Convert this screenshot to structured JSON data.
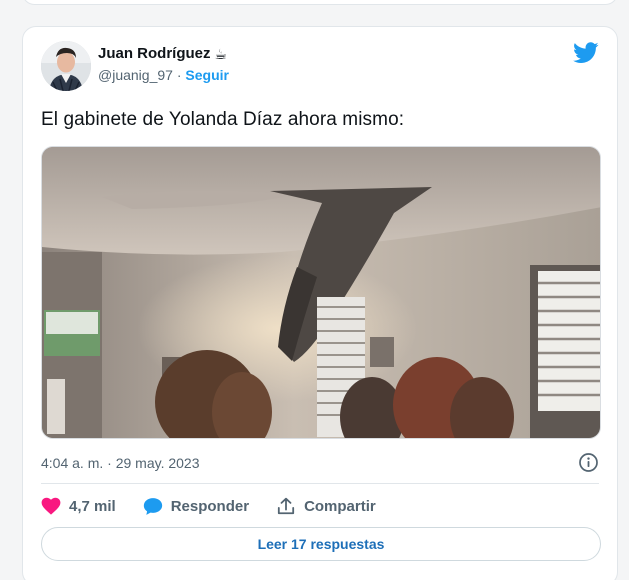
{
  "tweet": {
    "author_name": "Juan Rodríguez",
    "author_emoji": "☕",
    "handle": "@juanig_97",
    "separator": " · ",
    "follow_label": "Seguir",
    "text": "El gabinete de Yolanda Díaz ahora mismo:",
    "media_icon": "embedded-video-still",
    "timestamp": "4:04 a. m. · 29 may. 2023",
    "likes": "4,7 mil",
    "reply_label": "Responder",
    "share_label": "Compartir",
    "read_replies_label": "Leer 17 respuestas"
  },
  "icons": {
    "brand": "twitter-bird-icon",
    "info": "info-icon",
    "like": "heart-icon",
    "reply": "speech-bubble-icon",
    "share": "share-upload-icon"
  },
  "colors": {
    "brand_blue": "#1d9bf0",
    "heart": "#f91880",
    "reply_bubble": "#1d9bf0",
    "link_blue": "#1d6fb8",
    "muted": "#536471"
  }
}
